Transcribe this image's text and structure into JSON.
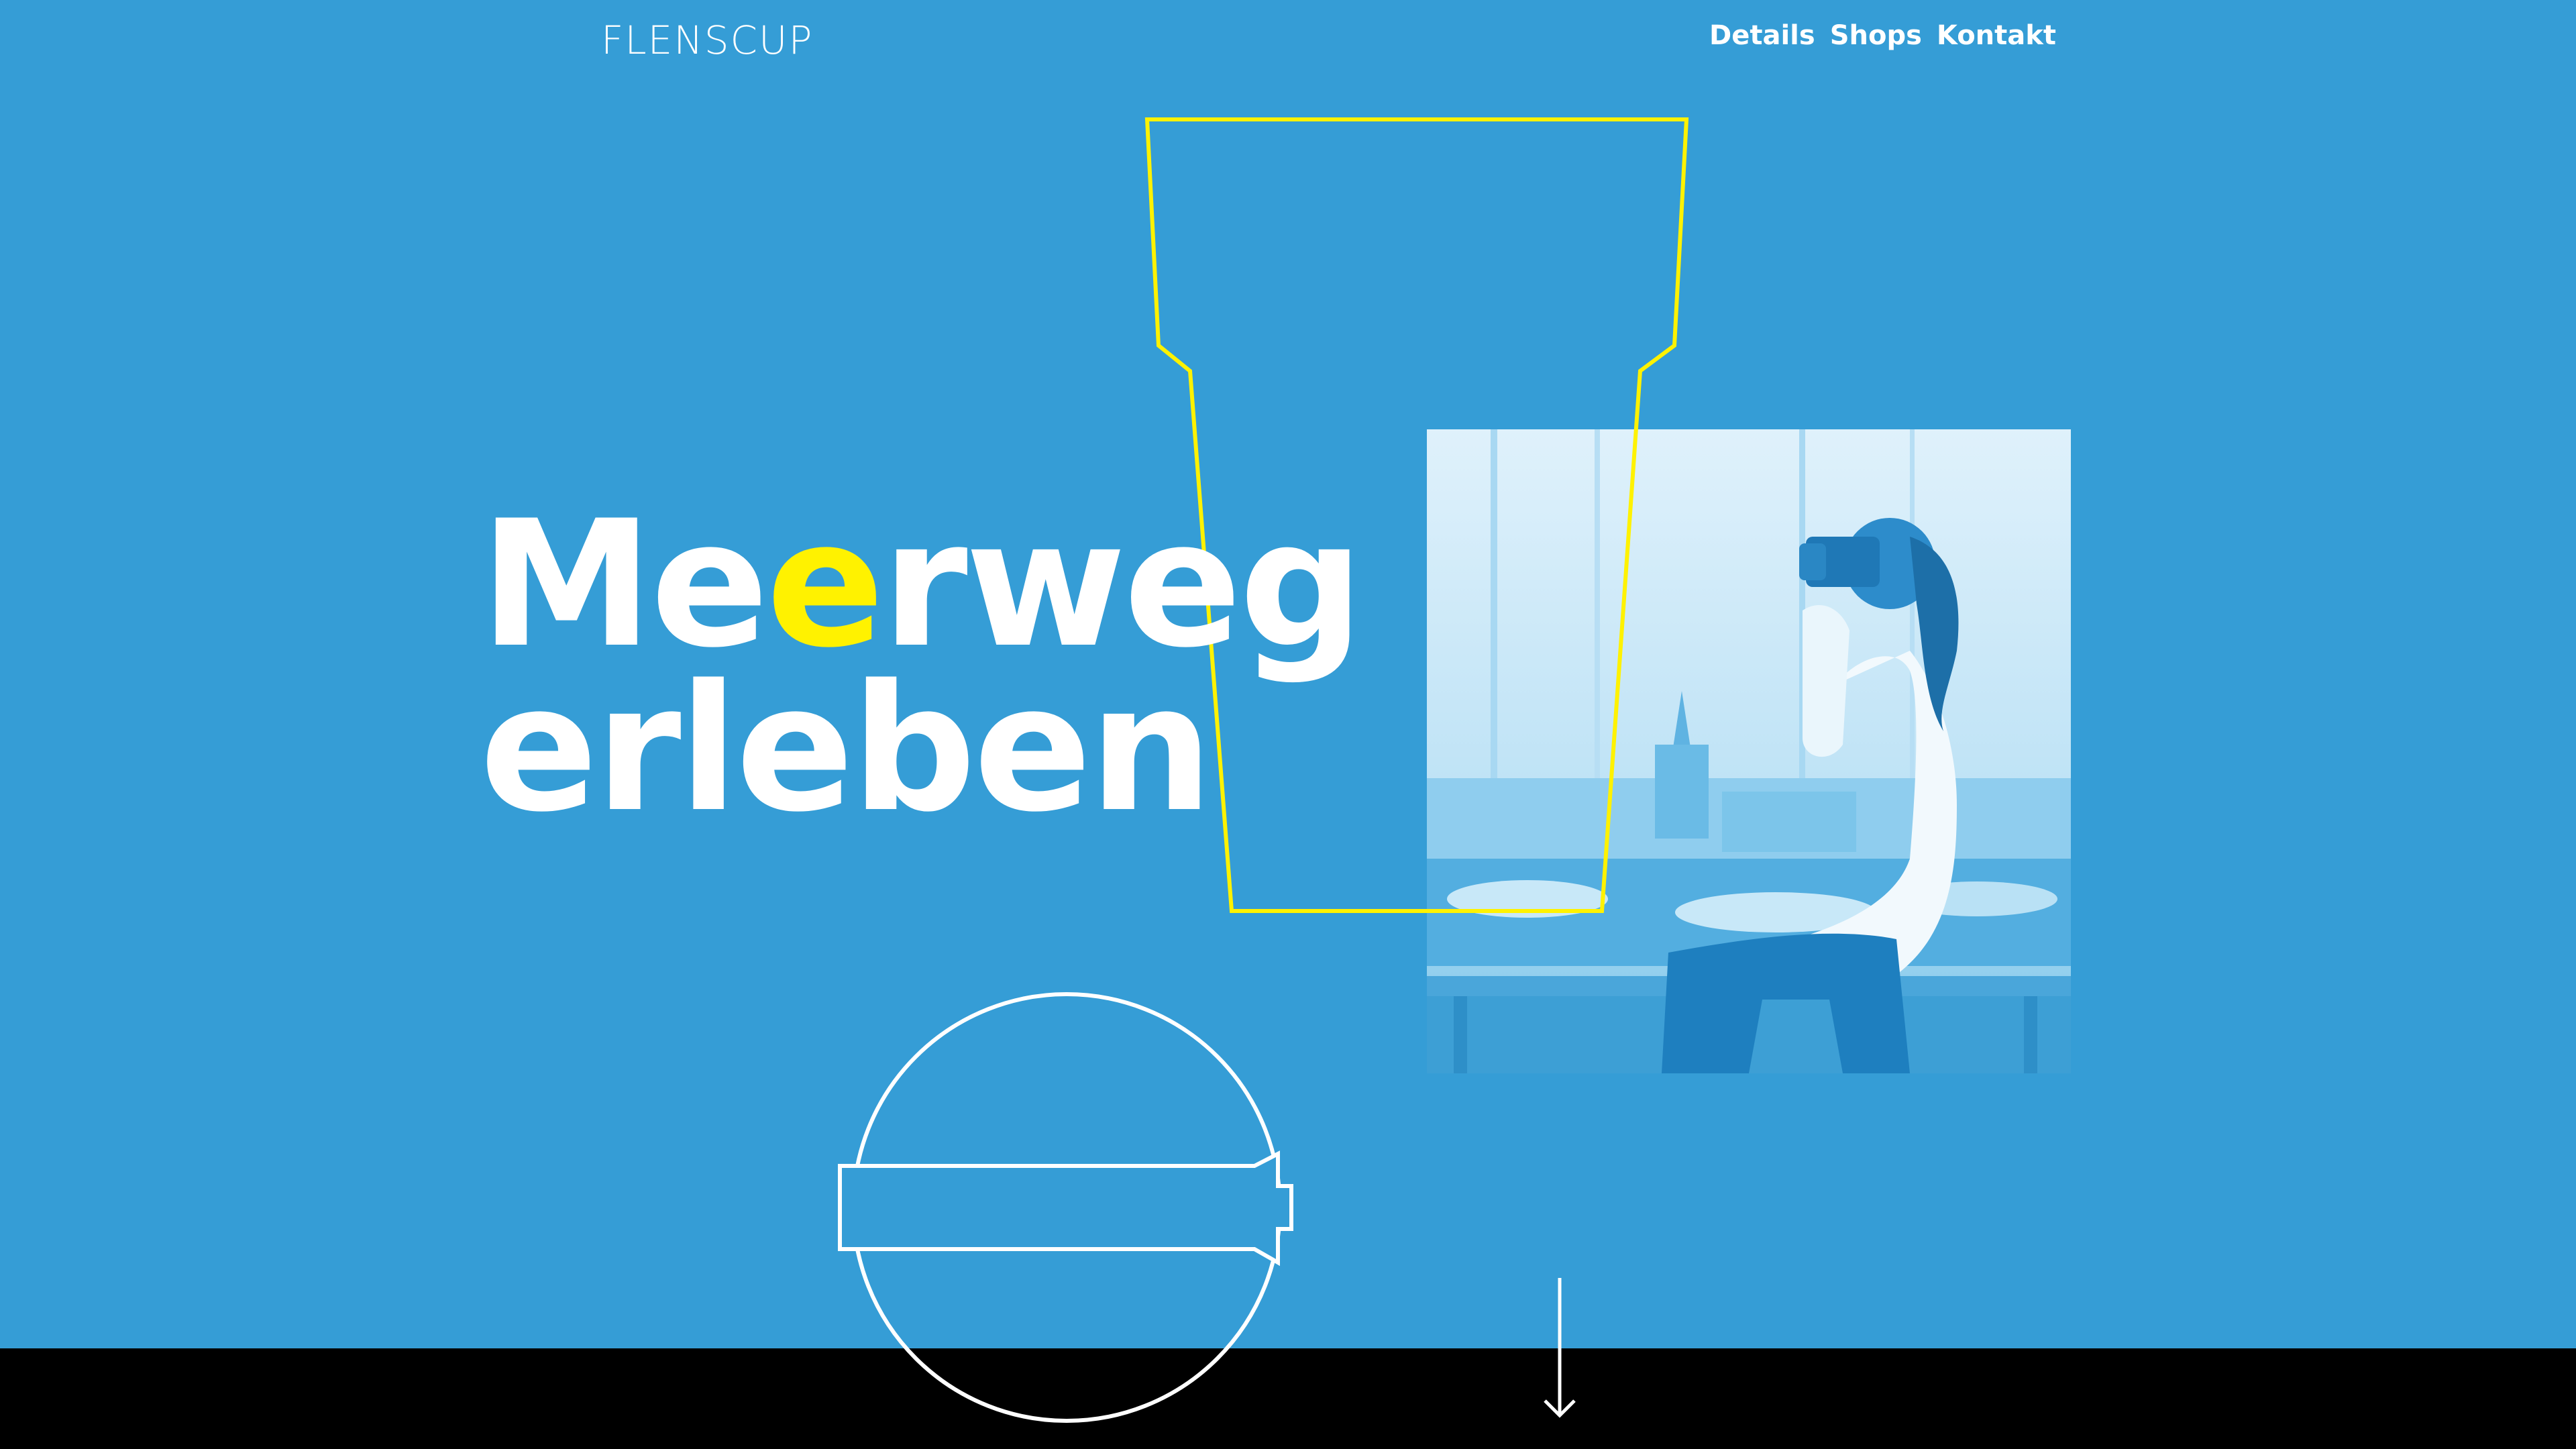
{
  "header": {
    "logo_text": "FLENSCUP",
    "nav": [
      {
        "label": "Details"
      },
      {
        "label": "Shops"
      },
      {
        "label": "Kontakt"
      }
    ]
  },
  "hero": {
    "headline_line1_part1": "Me",
    "headline_line1_accent": "e",
    "headline_line1_part2": "rweg",
    "headline_line2": "erleben"
  },
  "colors": {
    "background": "#359DD6",
    "accent": "#FFF200",
    "text": "#FFFFFF",
    "footer": "#000000"
  },
  "icons": {
    "scroll": "arrow-down-icon",
    "cup": "cup-outline-illustration",
    "lid": "lid-outline-illustration"
  }
}
